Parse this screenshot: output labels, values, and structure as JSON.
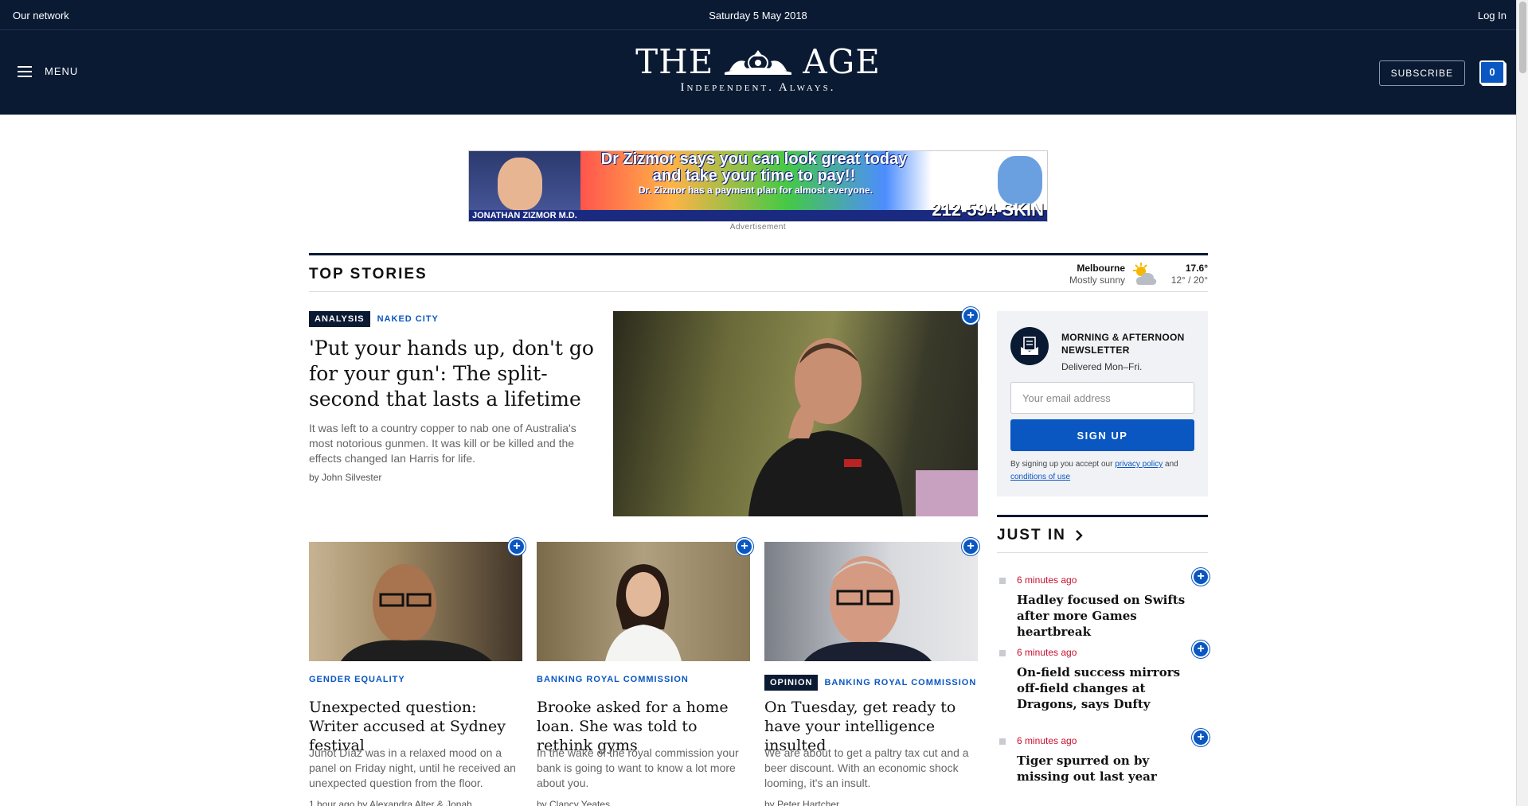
{
  "util_bar": {
    "network": "Our network",
    "date": "Saturday 5 May 2018",
    "login": "Log In"
  },
  "masthead": {
    "menu_label": "MENU",
    "logo_left": "THE",
    "logo_right": "AGE",
    "tagline": "Independent. Always.",
    "subscribe_label": "SUBSCRIBE",
    "saved_count": "0",
    "colors": {
      "navy": "#0a1a33",
      "accent_blue": "#0a57c2",
      "timestamp_red": "#c8102e"
    }
  },
  "ad": {
    "headline_line1": "Dr Zizmor says you can look great today",
    "headline_line2": "and take your time to pay!!",
    "sub": "Dr. Zizmor has a payment plan for almost everyone.",
    "doctor": "JONATHAN ZIZMOR M.D.",
    "phone": "212-594-SKIN",
    "label": "Advertisement"
  },
  "section": {
    "title": "TOP STORIES"
  },
  "weather": {
    "city": "Melbourne",
    "condition": "Mostly sunny",
    "icon": "partly-sunny-icon",
    "temp": "17.6°",
    "range": "12° / 20°"
  },
  "lead_story": {
    "tag": "ANALYSIS",
    "category": "NAKED CITY",
    "headline": "'Put your hands up, don't go for your gun': The split-second that lasts a lifetime",
    "summary": "It was left to a country copper to nab one of Australia's most notorious gunmen. It was kill or be killed and the effects changed Ian Harris for life.",
    "byline": "by John Silvester"
  },
  "stories": [
    {
      "category": "GENDER EQUALITY",
      "headline": "Unexpected question: Writer accused at Sydney festival",
      "summary": "Junot Díaz was in a relaxed mood on a panel on Friday night, until he received an unexpected question from the floor.",
      "byline": "1 hour ago   by Alexandra Alter & Jonah"
    },
    {
      "category": "BANKING ROYAL COMMISSION",
      "headline": "Brooke asked for a home loan. She was told to rethink gyms",
      "summary": "In the wake of the royal commission your bank is going to want to know a lot more about you.",
      "byline": "by Clancy Yeates"
    },
    {
      "tag": "OPINION",
      "category": "BANKING ROYAL COMMISSION",
      "headline": "On Tuesday, get ready to have your intelligence insulted",
      "summary": "We are about to get a paltry tax cut and a beer discount. With an economic shock looming, it's an insult.",
      "byline": "by Peter Hartcher"
    }
  ],
  "newsletter": {
    "title": "MORNING & AFTERNOON NEWSLETTER",
    "subtitle": "Delivered Mon–Fri.",
    "email_placeholder": "Your email address",
    "button_label": "SIGN UP",
    "legal_prefix": "By signing up you accept our",
    "privacy_link": "privacy policy",
    "legal_and": "and",
    "conditions_link": "conditions of use"
  },
  "just_in": {
    "title": "JUST IN",
    "items": [
      {
        "time": "6 minutes ago",
        "headline": "Hadley focused on Swifts after more Games heartbreak"
      },
      {
        "time": "6 minutes ago",
        "headline": "On-field success mirrors off-field changes at Dragons, says Dufty"
      },
      {
        "time": "6 minutes ago",
        "headline": "Tiger spurred on by missing out last year"
      }
    ]
  },
  "plus_symbol": "+"
}
